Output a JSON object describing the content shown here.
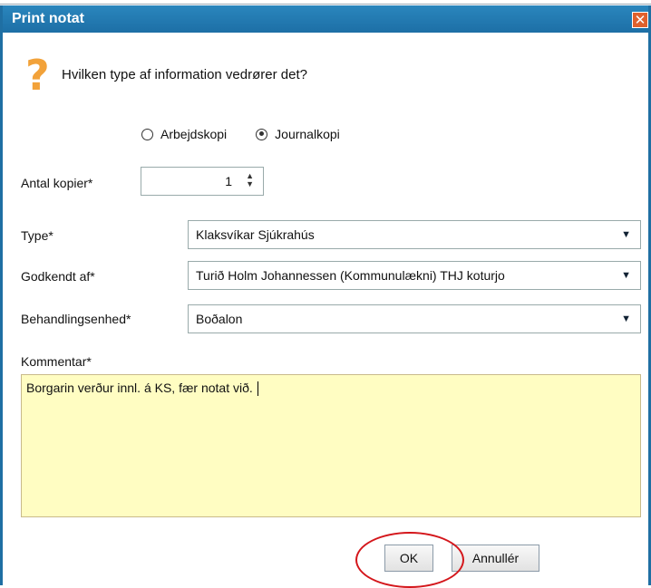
{
  "dialog": {
    "title": "Print notat",
    "close_label": "✕"
  },
  "question_icon": "?",
  "question": "Hvilken type af information vedrører det?",
  "radios": [
    {
      "label": "Arbejdskopi",
      "checked": false
    },
    {
      "label": "Journalkopi",
      "checked": true
    }
  ],
  "fields": {
    "antal_label": "Antal kopier*",
    "antal_value": "1",
    "type_label": "Type*",
    "type_value": "Klaksvíkar Sjúkrahús",
    "godkendt_label": "Godkendt af*",
    "godkendt_value": "Turið Holm Johannessen (Kommunulækni) THJ koturjo",
    "behandling_label": "Behandlingsenhed*",
    "behandling_value": "Boðalon",
    "kommentar_label": "Kommentar*",
    "kommentar_value": "Borgarin verður innl. á KS, fær notat við."
  },
  "buttons": {
    "ok": "OK",
    "cancel": "Annullér"
  },
  "colors": {
    "title_bar": "#1d6fa6",
    "question_icon": "#f2a23a",
    "comment_bg": "#fffdc2",
    "highlight_ring": "#d4161b"
  }
}
